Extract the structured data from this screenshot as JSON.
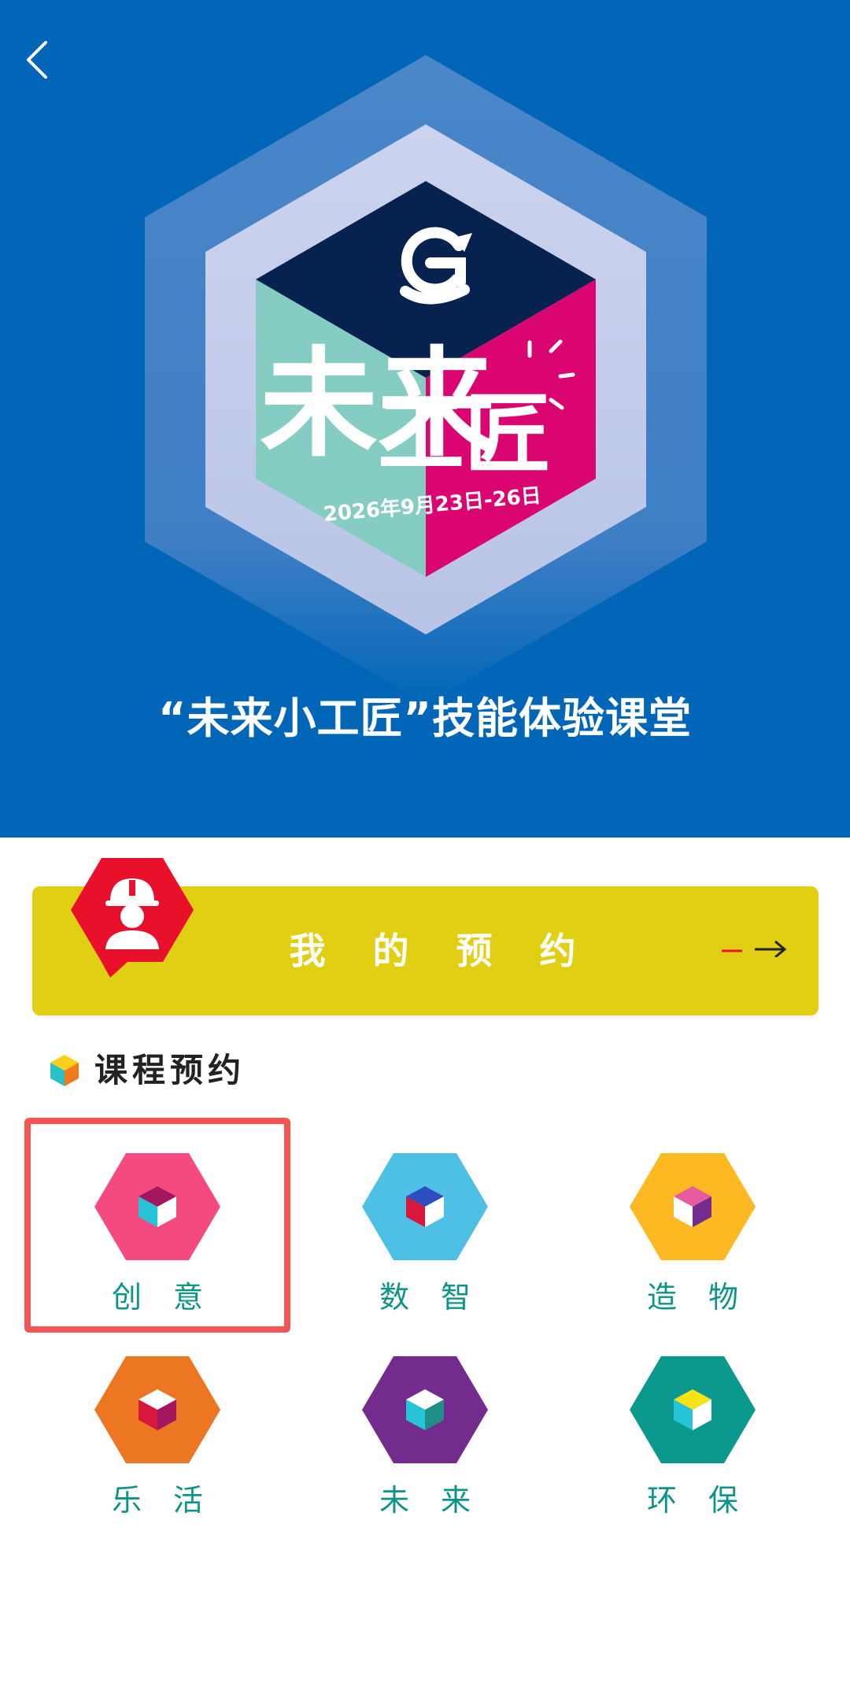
{
  "header": {
    "back_icon": "chevron-left-icon",
    "logo_text": "未来工匠",
    "event_date": "2026年9月23日-26日",
    "title": "“未来小工匠”技能体验课堂"
  },
  "my_appointment": {
    "label": "我 的 预 约",
    "icon": "worker-helmet-icon",
    "arrow_icon": "arrow-right-icon"
  },
  "course_section": {
    "title": "课程预约",
    "icon": "cube-icon"
  },
  "categories": [
    {
      "label": "创 意",
      "color": "#f34b80",
      "selected": true
    },
    {
      "label": "数 智",
      "color": "#4ec0e6",
      "selected": false
    },
    {
      "label": "造 物",
      "color": "#fdb822",
      "selected": false
    },
    {
      "label": "乐 活",
      "color": "#ed7622",
      "selected": false
    },
    {
      "label": "未 来",
      "color": "#732c8e",
      "selected": false
    },
    {
      "label": "环 保",
      "color": "#0b998d",
      "selected": false
    }
  ],
  "colors": {
    "hero_bg": "#0166b7",
    "appointment_bg": "#e0cf12",
    "badge_red": "#e8102b",
    "label_teal": "#0b9487",
    "highlight": "#f55555"
  }
}
